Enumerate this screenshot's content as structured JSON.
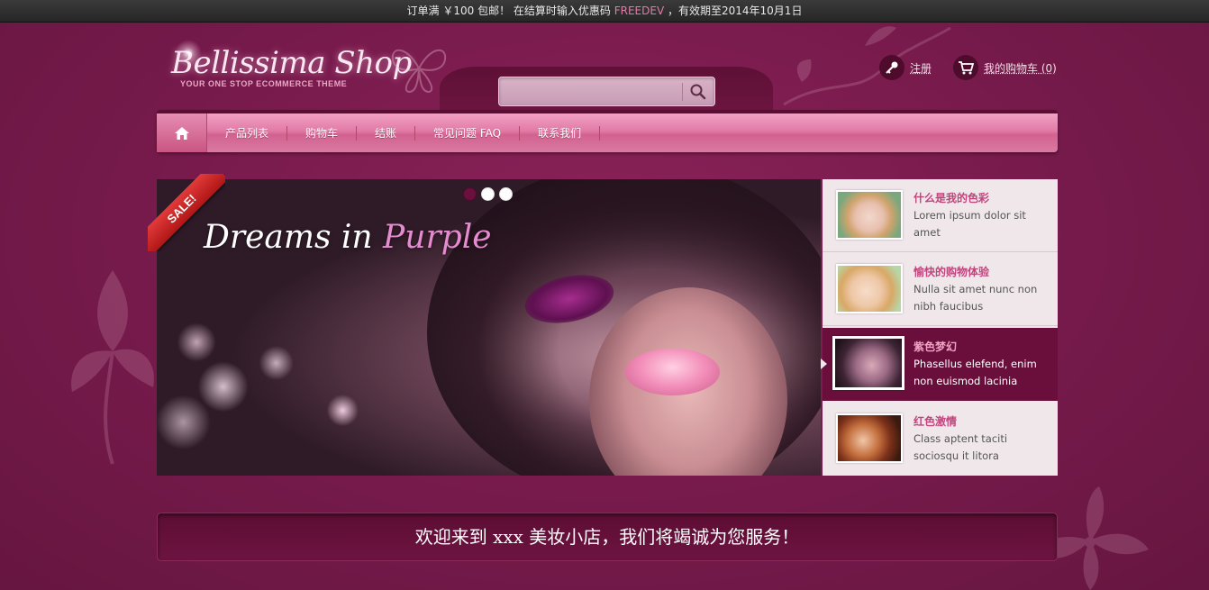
{
  "promo_bar": {
    "before": "订单满 ￥100 包邮！ 在结算时输入优惠码",
    "code": "FREEDEV",
    "after": "，有效期至2014年10月1日"
  },
  "logo": {
    "title": "Bellissima Shop",
    "tagline": "YOUR ONE STOP ECOMMERCE THEME"
  },
  "search": {
    "value": "",
    "placeholder": "",
    "icon": "search-icon"
  },
  "account": {
    "register_label": "注册",
    "register_icon": "key-icon",
    "cart_label": "我的购物车 (0)",
    "cart_icon": "shopping-cart-icon"
  },
  "nav": {
    "home_icon": "home-icon",
    "items": [
      {
        "label": "产品列表"
      },
      {
        "label": "购物车"
      },
      {
        "label": "结账"
      },
      {
        "label": "常见问题 FAQ"
      },
      {
        "label": "联系我们"
      }
    ]
  },
  "slider": {
    "badge": "SALE!",
    "headline_part1": "Dreams in ",
    "headline_part2": "Purple",
    "dots": 3,
    "active_dot": 0
  },
  "thumbnails": [
    {
      "title": "什么是我的色彩",
      "desc": "Lorem ipsum dolor sit amet",
      "active": false
    },
    {
      "title": "愉快的购物体验",
      "desc": "Nulla sit amet nunc non nibh faucibus",
      "active": false
    },
    {
      "title": "紫色梦幻",
      "desc": "Phasellus elefend, enim non euismod lacinia",
      "active": true
    },
    {
      "title": "红色激情",
      "desc": "Class aptent taciti sociosqu it litora",
      "active": false
    }
  ],
  "welcome": "欢迎来到 xxx 美妆小店，我们将竭诚为您服务！",
  "colors": {
    "background": "#7a1d4e",
    "accent_pink": "#e27aa8",
    "nav_pink": "#e17aa7",
    "dark_plum": "#6a0f3c",
    "sale_red": "#c41e1e"
  }
}
